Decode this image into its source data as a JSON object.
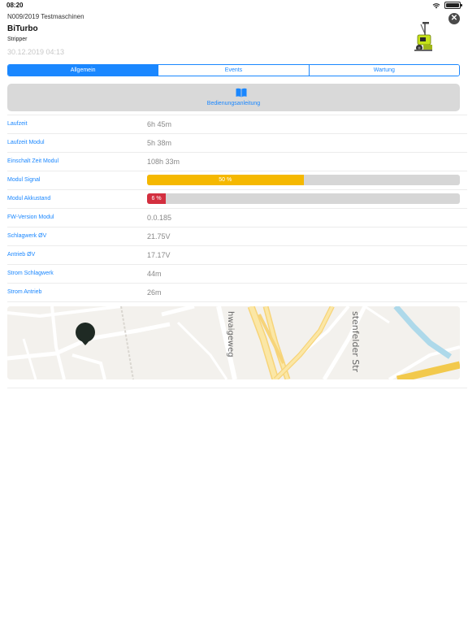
{
  "status_bar": {
    "time": "08:20"
  },
  "header": {
    "id_line": "N009/2019  Testmaschinen",
    "title": "BiTurbo",
    "subtitle": "Stripper",
    "date": "30.12.2019 04:13",
    "close_symbol": "✕",
    "image_icon": "machine-illustration-icon"
  },
  "tabs": [
    {
      "label": "Allgemein",
      "active": true
    },
    {
      "label": "Events",
      "active": false
    },
    {
      "label": "Wartung",
      "active": false
    }
  ],
  "manual_button": {
    "label": "Bedienungsanleitung",
    "icon": "book-icon"
  },
  "rows": [
    {
      "label": "Laufzeit",
      "value": "6h 45m"
    },
    {
      "label": "Laufzeit Modul",
      "value": "5h 38m"
    },
    {
      "label": "Einschalt Zeit Modul",
      "value": "108h 33m"
    },
    {
      "label": "Modul Signal",
      "bar_text": "50 %",
      "percent": 50,
      "color": "#f5b800"
    },
    {
      "label": "Modul Akkustand",
      "bar_text": "6 %",
      "percent": 6,
      "color": "#d32f3f"
    },
    {
      "label": "FW-Version Modul",
      "value": "0.0.185"
    },
    {
      "label": "Schlagwerk ØV",
      "value": "21.75V"
    },
    {
      "label": "Antrieb ØV",
      "value": "17.17V"
    },
    {
      "label": "Strom Schlagwerk",
      "value": "44m"
    },
    {
      "label": "Strom Antrieb",
      "value": "26m"
    }
  ],
  "map": {
    "street_labels": [
      "hwaigeweg",
      "stenfelder Str"
    ],
    "marker_icon": "location-pin-icon"
  },
  "colors": {
    "accent": "#1a87ff",
    "signal": "#f5b800",
    "battery_low": "#d32f3f"
  }
}
